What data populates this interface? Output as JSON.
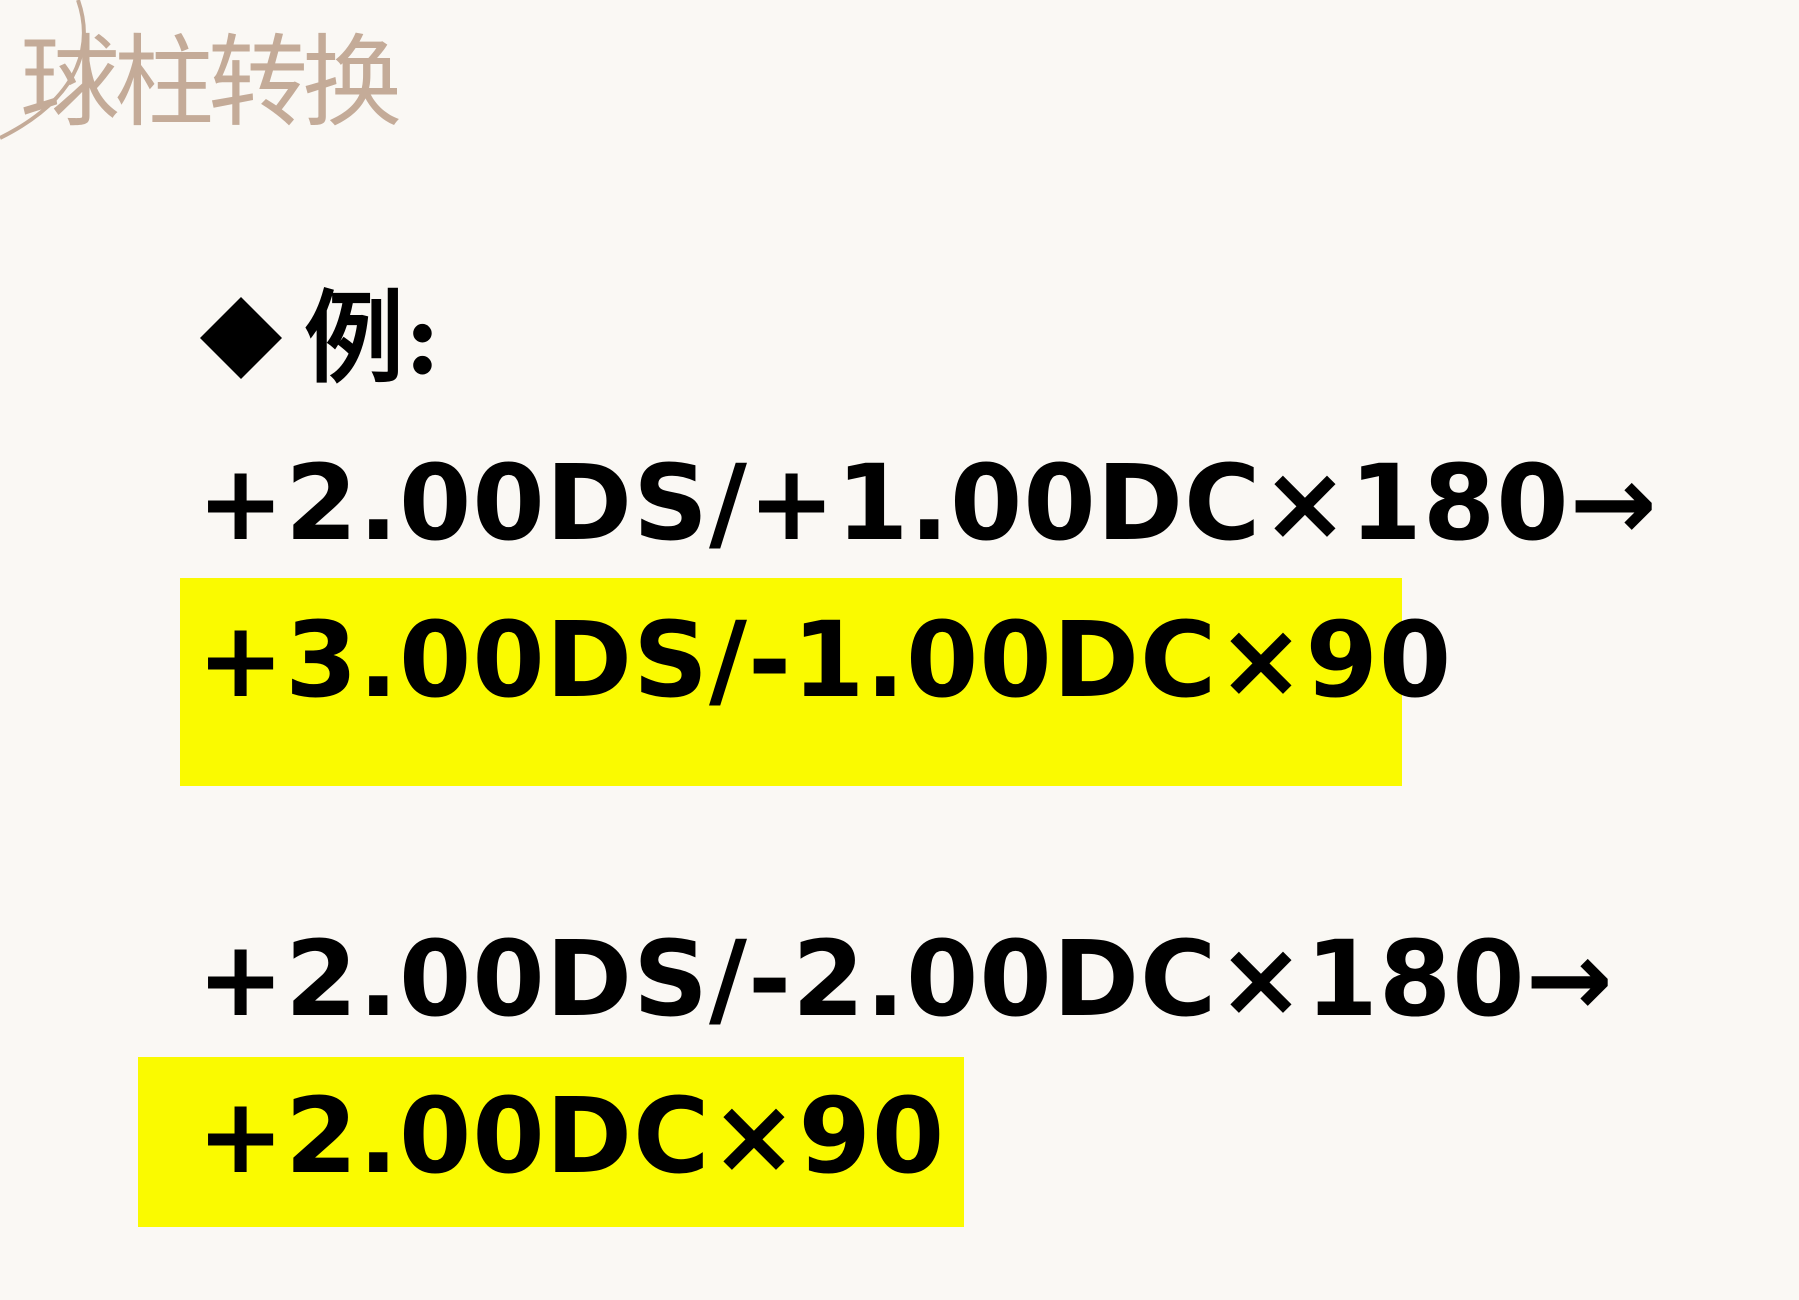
{
  "title": "球柱转换",
  "colors": {
    "accent": "#c4ab98",
    "highlight": "#fafa00",
    "text": "#000000",
    "background": "#faf8f4"
  },
  "bullet": {
    "icon": "diamond-bullet-icon",
    "label": "例:"
  },
  "examples": [
    {
      "input": "+2.00DS/+1.00DC×180→",
      "result": "+3.00DS/-1.00DC×90"
    },
    {
      "input": "+2.00DS/-2.00DC×180→",
      "result": "+2.00DC×90"
    }
  ]
}
